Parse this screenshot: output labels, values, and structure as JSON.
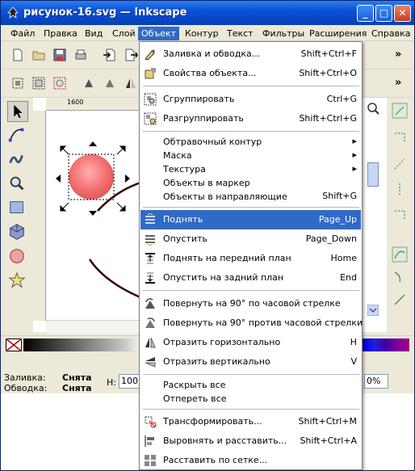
{
  "window": {
    "title": "рисунок-16.svg — Inkscape",
    "buttons": {
      "minimize": "_",
      "maximize": "□",
      "close": "✕"
    }
  },
  "menubar": {
    "items": [
      "Файл",
      "Правка",
      "Вид",
      "Слой",
      "Объект",
      "Контур",
      "Текст",
      "Фильтры",
      "Расширения",
      "Справка"
    ],
    "active": "Объект"
  },
  "toolbar": {
    "overflow": "»"
  },
  "ruler": {
    "label": "1600"
  },
  "status": {
    "fill_label": "Заливка:",
    "fill_value": "Снята",
    "stroke_label": "Обводка:",
    "stroke_value": "Снята",
    "h_label": "H:",
    "h_value": "100",
    "zoom_value": "0%"
  },
  "object_menu": {
    "items": [
      {
        "label": "Заливка и обводка...",
        "accel": "Shift+Ctrl+F",
        "icon": "fill-stroke-icon"
      },
      {
        "label": "Свойства объекта...",
        "accel": "Shift+Ctrl+O",
        "icon": "object-properties-icon"
      },
      {
        "label": "Сгруппировать",
        "accel": "Ctrl+G",
        "icon": "group-icon"
      },
      {
        "label": "Разгруппировать",
        "accel": "Shift+Ctrl+G",
        "icon": "ungroup-icon"
      },
      {
        "label": "Обтравочный контур",
        "accel": "▸",
        "icon": ""
      },
      {
        "label": "Маска",
        "accel": "▸",
        "icon": ""
      },
      {
        "label": "Текстура",
        "accel": "▸",
        "icon": ""
      },
      {
        "label": "Объекты в маркер",
        "accel": "",
        "icon": ""
      },
      {
        "label": "Объекты в направляющие",
        "accel": "Shift+G",
        "icon": ""
      },
      {
        "label": "Поднять",
        "accel": "Page_Up",
        "icon": "raise-icon"
      },
      {
        "label": "Опустить",
        "accel": "Page_Down",
        "icon": "lower-icon"
      },
      {
        "label": "Поднять на передний план",
        "accel": "Home",
        "icon": "raise-to-top-icon"
      },
      {
        "label": "Опустить на задний план",
        "accel": "End",
        "icon": "lower-to-bottom-icon"
      },
      {
        "label": "Повернуть на 90° по часовой стрелке",
        "accel": "",
        "icon": "rotate-cw-icon"
      },
      {
        "label": "Повернуть на 90° против часовой стрелки",
        "accel": "",
        "icon": "rotate-ccw-icon"
      },
      {
        "label": "Отразить горизонтально",
        "accel": "H",
        "icon": "flip-horizontal-icon"
      },
      {
        "label": "Отразить вертикально",
        "accel": "V",
        "icon": "flip-vertical-icon"
      },
      {
        "label": "Раскрыть все",
        "accel": "",
        "icon": ""
      },
      {
        "label": "Отпереть все",
        "accel": "",
        "icon": ""
      },
      {
        "label": "Трансформировать...",
        "accel": "Shift+Ctrl+M",
        "icon": "transform-icon"
      },
      {
        "label": "Выровнять и расставить...",
        "accel": "Shift+Ctrl+A",
        "icon": "align-distribute-icon"
      },
      {
        "label": "Расставить по сетке...",
        "accel": "",
        "icon": "arrange-grid-icon"
      }
    ],
    "highlighted": "Поднять"
  },
  "colors": {
    "accent": "#316ac5",
    "titlebar": "#0a52d6",
    "circle_fill": "#f26a6a",
    "circle_stroke": "#3a0000"
  }
}
